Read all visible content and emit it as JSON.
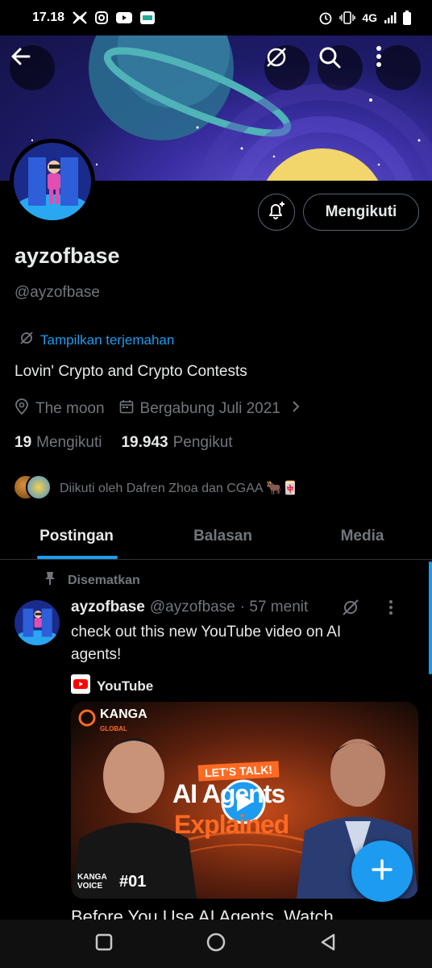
{
  "status_bar": {
    "time": "17.18",
    "network": "4G",
    "icons": [
      "x-icon",
      "instagram-icon",
      "youtube-icon",
      "app-icon",
      "alarm-icon",
      "vibrate-icon",
      "signal-icon",
      "battery-icon"
    ]
  },
  "header": {
    "back_icon": "arrow-left-icon",
    "actions": [
      "translate-off-icon",
      "search-icon",
      "more-vertical-icon"
    ]
  },
  "profile": {
    "bell_icon": "bell-plus-icon",
    "follow_label": "Mengikuti",
    "display_name": "ayzofbase",
    "handle": "@ayzofbase",
    "translate_label": "Tampilkan terjemahan",
    "bio": "Lovin' Crypto and Crypto Contests",
    "location": "The moon",
    "joined": "Bergabung Juli 2021",
    "following_count": "19",
    "following_label": "Mengikuti",
    "followers_count": "19.943",
    "followers_label": "Pengikut",
    "followed_by": "Diikuti oleh Dafren Zhoa dan CGAA 🐂🀄"
  },
  "tabs": [
    {
      "label": "Postingan",
      "active": true
    },
    {
      "label": "Balasan",
      "active": false
    },
    {
      "label": "Media",
      "active": false
    }
  ],
  "post": {
    "pinned_label": "Disematkan",
    "author_name": "ayzofbase",
    "author_handle": "@ayzofbase",
    "time": "· 57 menit",
    "text": "check out this new YouTube video on AI agents!",
    "source": "YouTube",
    "video": {
      "brand": "KANGA",
      "brand_sub": "GLOBAL",
      "tag": "LET'S TALK!",
      "headline_1": "AI Agents",
      "headline_2": "Explained",
      "series": "KANGA VOICE",
      "episode": "#01"
    },
    "video_title": "Before You Use AI Agents, Watch"
  },
  "colors": {
    "accent": "#1d9bf0",
    "background": "#000000",
    "text": "#e7e9ea",
    "muted": "#71767b"
  }
}
